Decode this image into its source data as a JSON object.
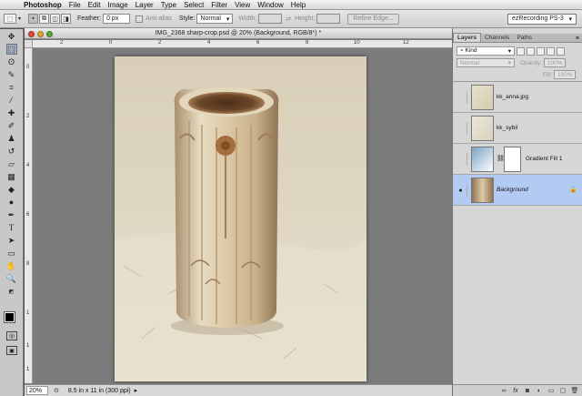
{
  "menubar": {
    "apple": "",
    "app": "Photoshop",
    "items": [
      "File",
      "Edit",
      "Image",
      "Layer",
      "Type",
      "Select",
      "Filter",
      "View",
      "Window",
      "Help"
    ]
  },
  "options": {
    "feather_label": "Feather:",
    "feather_value": "0 px",
    "antialias_label": "Anti-alias",
    "style_label": "Style:",
    "style_value": "Normal",
    "width_label": "Width:",
    "height_label": "Height:",
    "refine_label": "Refine Edge...",
    "workspace": "ezRecording PS-3"
  },
  "document": {
    "title": "IMG_2368 sharp-crop.psd @ 20% (Background, RGB/8*) *",
    "zoom": "20%",
    "status": "8.5 in x 11 in (300 ppi)",
    "ruler_h_labels": [
      "2",
      "0",
      "2",
      "4",
      "6",
      "8",
      "10",
      "12"
    ],
    "ruler_v_labels": [
      "0",
      "2",
      "4",
      "6",
      "8",
      "1",
      "1",
      "1"
    ]
  },
  "panel": {
    "tabs": [
      "Layers",
      "Channels",
      "Paths"
    ],
    "filter_label": "Kind",
    "blend_mode": "Normal",
    "opacity_label": "Opacity:",
    "opacity_value": "100%",
    "fill_label": "Fill:",
    "fill_value": "100%",
    "layers": [
      {
        "name": "kk_anna.jpg",
        "visible": false
      },
      {
        "name": "kk_sybil",
        "visible": false
      },
      {
        "name": "Gradient Fill 1",
        "visible": false
      },
      {
        "name": "Background",
        "visible": true,
        "locked": true
      }
    ]
  }
}
